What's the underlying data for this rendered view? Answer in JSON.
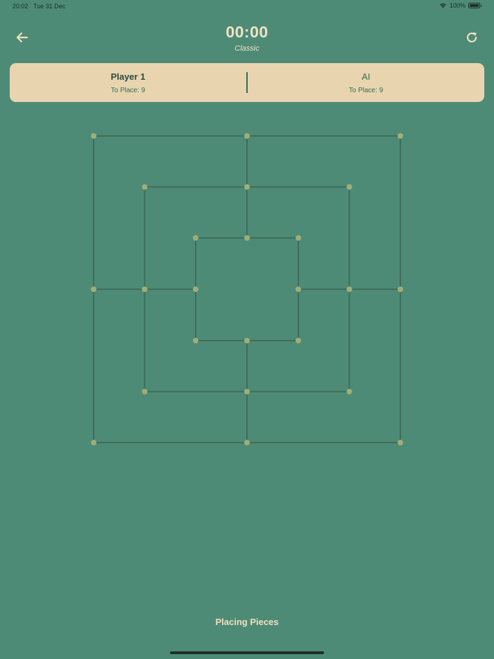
{
  "status_bar": {
    "time": "20:02",
    "date": "Tue 31 Dec",
    "battery_text": "100%",
    "battery_level": 1.0
  },
  "header": {
    "timer": "00:00",
    "mode": "Classic",
    "back_icon": "arrow-left-icon",
    "restart_icon": "refresh-icon"
  },
  "players": [
    {
      "name": "Player 1",
      "to_place": "To Place: 9",
      "active": true
    },
    {
      "name": "AI",
      "to_place": "To Place: 9",
      "active": false
    }
  ],
  "board": {
    "type": "nine-mens-morris",
    "line_color": "#3e6d5a",
    "point_color": "#9fae79",
    "rings": 3,
    "points": [
      {
        "ring": 0,
        "pos": 0
      },
      {
        "ring": 0,
        "pos": 1
      },
      {
        "ring": 0,
        "pos": 2
      },
      {
        "ring": 0,
        "pos": 3
      },
      {
        "ring": 0,
        "pos": 4
      },
      {
        "ring": 0,
        "pos": 5
      },
      {
        "ring": 0,
        "pos": 6
      },
      {
        "ring": 0,
        "pos": 7
      },
      {
        "ring": 1,
        "pos": 0
      },
      {
        "ring": 1,
        "pos": 1
      },
      {
        "ring": 1,
        "pos": 2
      },
      {
        "ring": 1,
        "pos": 3
      },
      {
        "ring": 1,
        "pos": 4
      },
      {
        "ring": 1,
        "pos": 5
      },
      {
        "ring": 1,
        "pos": 6
      },
      {
        "ring": 1,
        "pos": 7
      },
      {
        "ring": 2,
        "pos": 0
      },
      {
        "ring": 2,
        "pos": 1
      },
      {
        "ring": 2,
        "pos": 2
      },
      {
        "ring": 2,
        "pos": 3
      },
      {
        "ring": 2,
        "pos": 4
      },
      {
        "ring": 2,
        "pos": 5
      },
      {
        "ring": 2,
        "pos": 6
      },
      {
        "ring": 2,
        "pos": 7
      }
    ]
  },
  "phase": "Placing Pieces",
  "colors": {
    "background": "#4e8b76",
    "panel": "#e8d5b0",
    "accent_text": "#336b57"
  }
}
